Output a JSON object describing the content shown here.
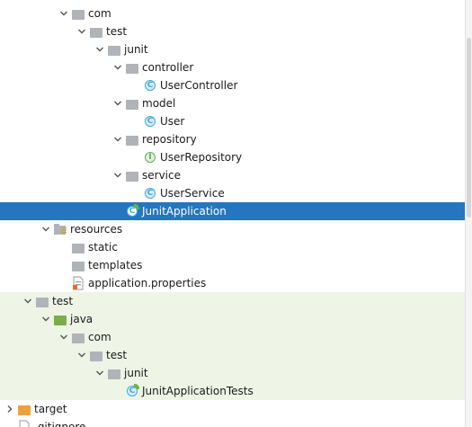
{
  "colors": {
    "folder": "#b0b3b8",
    "source_folder_test": "#7bae4a",
    "resources_folder": "#b0b3b8",
    "selection": "#2675bf",
    "test_row_bg": "#eef4e6",
    "class_badge": "#3ea8dd",
    "interface_badge": "#5fb05c",
    "target_folder": "#f0a040"
  },
  "tree": {
    "items": [
      {
        "label": "com",
        "depth": 3,
        "arrow": "expanded",
        "icon": "folder-icon"
      },
      {
        "label": "test",
        "depth": 4,
        "arrow": "expanded",
        "icon": "folder-icon"
      },
      {
        "label": "junit",
        "depth": 5,
        "arrow": "expanded",
        "icon": "folder-icon"
      },
      {
        "label": "controller",
        "depth": 6,
        "arrow": "expanded",
        "icon": "folder-icon"
      },
      {
        "label": "UserController",
        "depth": 7,
        "arrow": "none",
        "icon": "class-icon",
        "badge": "C"
      },
      {
        "label": "model",
        "depth": 6,
        "arrow": "expanded",
        "icon": "folder-icon"
      },
      {
        "label": "User",
        "depth": 7,
        "arrow": "none",
        "icon": "class-icon",
        "badge": "C"
      },
      {
        "label": "repository",
        "depth": 6,
        "arrow": "expanded",
        "icon": "folder-icon"
      },
      {
        "label": "UserRepository",
        "depth": 7,
        "arrow": "none",
        "icon": "interface-icon",
        "badge": "I"
      },
      {
        "label": "service",
        "depth": 6,
        "arrow": "expanded",
        "icon": "folder-icon"
      },
      {
        "label": "UserService",
        "depth": 7,
        "arrow": "none",
        "icon": "class-icon",
        "badge": "C"
      },
      {
        "label": "JunitApplication",
        "depth": 6,
        "arrow": "none",
        "icon": "spring-class-icon",
        "badge": "C",
        "selected": true
      },
      {
        "label": "resources",
        "depth": 2,
        "arrow": "expanded",
        "icon": "resources-folder-icon"
      },
      {
        "label": "static",
        "depth": 3,
        "arrow": "none",
        "icon": "folder-icon"
      },
      {
        "label": "templates",
        "depth": 3,
        "arrow": "none",
        "icon": "folder-icon"
      },
      {
        "label": "application.properties",
        "depth": 3,
        "arrow": "none",
        "icon": "properties-file-icon"
      },
      {
        "label": "test",
        "depth": 1,
        "arrow": "expanded",
        "icon": "folder-icon",
        "test": true
      },
      {
        "label": "java",
        "depth": 2,
        "arrow": "expanded",
        "icon": "test-source-folder-icon",
        "test": true
      },
      {
        "label": "com",
        "depth": 3,
        "arrow": "expanded",
        "icon": "folder-icon",
        "test": true
      },
      {
        "label": "test",
        "depth": 4,
        "arrow": "expanded",
        "icon": "folder-icon",
        "test": true
      },
      {
        "label": "junit",
        "depth": 5,
        "arrow": "expanded",
        "icon": "folder-icon",
        "test": true
      },
      {
        "label": "JunitApplicationTests",
        "depth": 6,
        "arrow": "none",
        "icon": "spring-class-icon",
        "badge": "C",
        "test": true
      },
      {
        "label": "target",
        "depth": 0,
        "arrow": "collapsed",
        "icon": "target-folder-icon"
      },
      {
        "label": ".gitignore",
        "depth": 0,
        "arrow": "none",
        "icon": "file-icon",
        "partial": true
      }
    ]
  }
}
